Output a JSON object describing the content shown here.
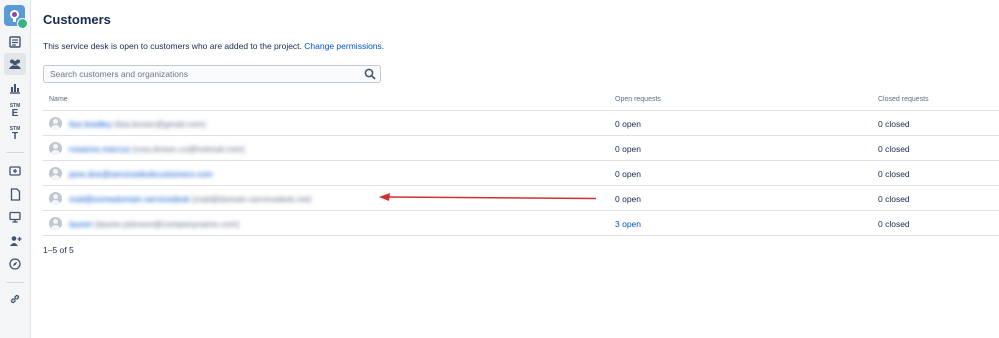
{
  "sidebar": {
    "items": [
      {
        "icon": "queues-icon"
      },
      {
        "icon": "customers-icon"
      },
      {
        "icon": "reports-icon"
      },
      {
        "icon": "stm-e-icon",
        "label_top": "STM",
        "label_big": "E"
      },
      {
        "icon": "stm-t-icon",
        "label_top": "STM",
        "label_big": "T"
      },
      {
        "icon": "raise-request-icon"
      },
      {
        "icon": "knowledge-base-icon"
      },
      {
        "icon": "channels-icon"
      },
      {
        "icon": "invite-team-icon"
      },
      {
        "icon": "explore-icon"
      },
      {
        "icon": "project-link-icon"
      }
    ]
  },
  "page": {
    "title": "Customers",
    "description": "This service desk is open to customers who are added to the project.",
    "change_permissions": "Change permissions."
  },
  "search": {
    "placeholder": "Search customers and organizations"
  },
  "table": {
    "headers": {
      "name": "Name",
      "open": "Open requests",
      "closed": "Closed requests"
    },
    "rows": [
      {
        "name": "lisa bradley",
        "email": "(lisa.brown@gmail.com)",
        "open": "0 open",
        "closed": "0 closed"
      },
      {
        "name": "rosanna marcus",
        "email": "(ross.brown.xx@hotmail.com)",
        "open": "0 open",
        "closed": "0 closed"
      },
      {
        "name": "jane.doe@servicedeskcustomers.com",
        "email": "",
        "open": "0 open",
        "closed": "0 closed"
      },
      {
        "name": "mail@somedomain-servicedesk",
        "email": "(mail@domain-servicedesk.net)",
        "open": "0 open",
        "closed": "0 closed"
      },
      {
        "name": "lauren",
        "email": "(lauren.johnson@companyname.com)",
        "open": "3 open",
        "closed": "0 closed"
      }
    ]
  },
  "pagination": {
    "text": "1–5 of 5"
  },
  "colors": {
    "link": "#0052cc",
    "annotation_arrow": "#d32f2f"
  }
}
